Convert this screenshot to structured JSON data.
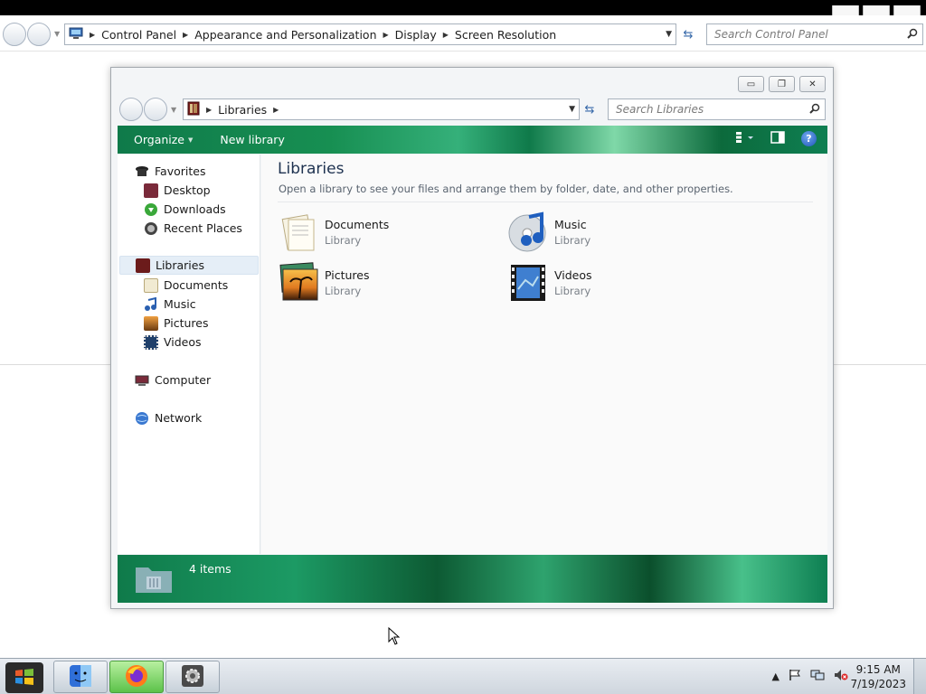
{
  "background_window": {
    "breadcrumb": [
      "Control Panel",
      "Appearance and Personalization",
      "Display",
      "Screen Resolution"
    ],
    "search_placeholder": "Search Control Panel"
  },
  "libraries_window": {
    "address": {
      "crumbs": [
        "Libraries"
      ]
    },
    "search_placeholder": "Search Libraries",
    "toolbar": {
      "organize": "Organize",
      "new_library": "New library"
    },
    "nav": {
      "favorites": {
        "label": "Favorites",
        "items": [
          "Desktop",
          "Downloads",
          "Recent Places"
        ]
      },
      "libraries": {
        "label": "Libraries",
        "items": [
          "Documents",
          "Music",
          "Pictures",
          "Videos"
        ]
      },
      "computer": "Computer",
      "network": "Network"
    },
    "content": {
      "title": "Libraries",
      "subtitle": "Open a library to see your files and arrange them by folder, date, and other properties.",
      "libraries": [
        {
          "name": "Documents",
          "type": "Library",
          "icon": "documents-library-icon"
        },
        {
          "name": "Music",
          "type": "Library",
          "icon": "music-library-icon"
        },
        {
          "name": "Pictures",
          "type": "Library",
          "icon": "pictures-library-icon"
        },
        {
          "name": "Videos",
          "type": "Library",
          "icon": "videos-library-icon"
        }
      ]
    },
    "details": {
      "item_count": "4 items"
    }
  },
  "taskbar": {
    "apps": [
      "finder-icon",
      "firefox-icon",
      "settings-icon"
    ],
    "clock": {
      "time": "9:15 AM",
      "date": "7/19/2023"
    }
  },
  "colors": {
    "accent_green": "#178f52",
    "selection_blue": "#e5eef7",
    "title_blue": "#1e3250"
  }
}
